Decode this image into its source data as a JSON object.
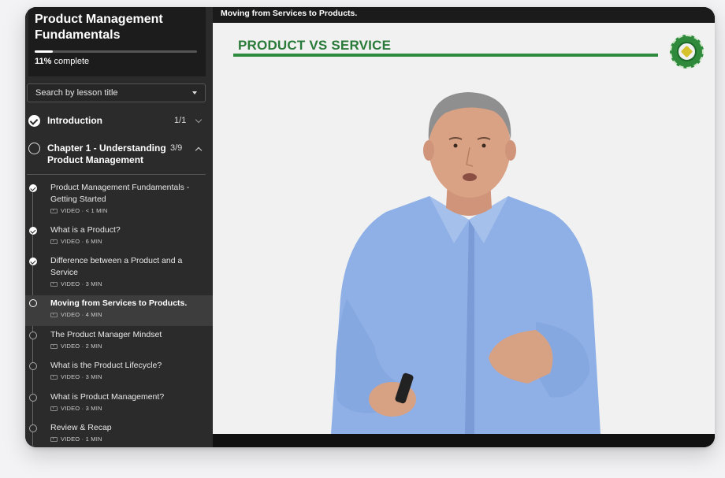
{
  "course": {
    "title": "Product Management Fundamentals",
    "progress_percent": 11,
    "progress_value": "11%",
    "progress_suffix": " complete"
  },
  "search": {
    "placeholder": "Search by lesson title"
  },
  "sections": [
    {
      "label": "Introduction",
      "count": "1/1",
      "status": "complete",
      "expanded": false
    },
    {
      "label": "Chapter 1 - Understanding Product Management",
      "count": "3/9",
      "status": "in-progress",
      "expanded": true
    }
  ],
  "lessons": [
    {
      "title": "Product Management Fundamentals - Getting Started",
      "meta": "VIDEO · < 1 MIN",
      "status": "complete"
    },
    {
      "title": "What is a Product?",
      "meta": "VIDEO · 6 MIN",
      "status": "complete"
    },
    {
      "title": "Difference between a Product and a Service",
      "meta": "VIDEO · 3 MIN",
      "status": "complete"
    },
    {
      "title": "Moving from Services to Products.",
      "meta": "VIDEO · 4 MIN",
      "status": "current"
    },
    {
      "title": "The Product Manager Mindset",
      "meta": "VIDEO · 2 MIN",
      "status": "incomplete"
    },
    {
      "title": "What is the Product Lifecycle?",
      "meta": "VIDEO · 3 MIN",
      "status": "incomplete"
    },
    {
      "title": "What is Product Management?",
      "meta": "VIDEO · 3 MIN",
      "status": "incomplete"
    },
    {
      "title": "Review & Recap",
      "meta": "VIDEO · 1 MIN",
      "status": "incomplete"
    }
  ],
  "main": {
    "lesson_title": "Moving from Services to Products.",
    "slide_title": "PRODUCT VS SERVICE"
  },
  "colors": {
    "accent_green": "#2e8b3e",
    "sidebar_bg": "#2b2b2b",
    "shirt_blue": "#8fb0e6"
  },
  "icons": [
    "check-circle-icon",
    "empty-circle-icon",
    "chevron-down-icon",
    "chevron-up-icon",
    "video-icon",
    "dropdown-caret-icon",
    "seal-badge-icon"
  ]
}
